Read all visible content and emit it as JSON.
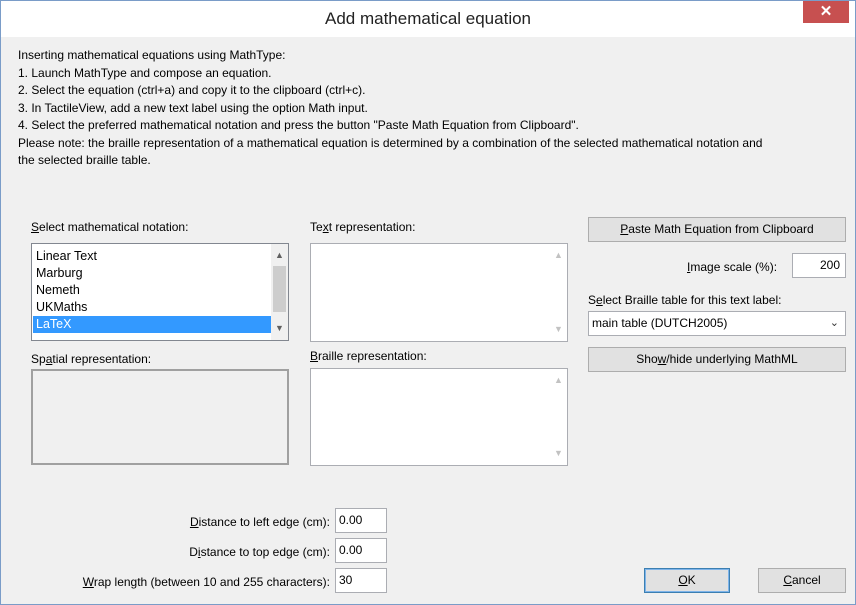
{
  "window": {
    "title": "Add mathematical equation",
    "close_glyph": "✕"
  },
  "instructions": [
    "Inserting mathematical equations using MathType:",
    "1. Launch MathType and compose an equation.",
    "2. Select the equation (ctrl+a) and copy it to the clipboard (ctrl+c).",
    "3. In TactileView, add a new text label using the option Math input.",
    "4. Select the preferred mathematical notation and press the button  \"Paste Math Equation from Clipboard\".",
    "Please note: the braille representation of a mathematical equation is determined by a combination of the selected mathematical notation and",
    "the selected braille table."
  ],
  "notation": {
    "label_mnemonic": "S",
    "label_rest": "elect mathematical notation:",
    "items": [
      "Linear Text",
      "Marburg",
      "Nemeth",
      "UKMaths",
      "LaTeX"
    ],
    "selected": "LaTeX"
  },
  "text_repr": {
    "label_pre": "Te",
    "label_mnemonic": "x",
    "label_post": "t representation:"
  },
  "braille_repr": {
    "label_mnemonic": "B",
    "label_rest": "raille representation:"
  },
  "spatial": {
    "label_pre": "Sp",
    "label_mnemonic": "a",
    "label_post": "tial representation:"
  },
  "paste_button": {
    "mnemonic": "P",
    "rest": "aste Math Equation from Clipboard"
  },
  "image_scale": {
    "label_mnemonic": "I",
    "label_rest": "mage scale (%):",
    "value": "200"
  },
  "braille_table": {
    "label_pre": "S",
    "label_mnemonic": "e",
    "label_post": "lect Braille table for this text label:",
    "selected": "main table (DUTCH2005)"
  },
  "mathml_button": {
    "pre": "Sho",
    "mnemonic": "w",
    "post": "/hide underlying MathML"
  },
  "distance_left": {
    "label_mnemonic": "D",
    "label_rest": "istance to left edge (cm):",
    "value": "0.00"
  },
  "distance_top": {
    "label_pre": "D",
    "label_mnemonic": "i",
    "label_post": "stance to top edge (cm):",
    "value": "0.00"
  },
  "wrap_length": {
    "label_mnemonic": "W",
    "label_rest": "rap length (between 10 and 255 characters):",
    "value": "30"
  },
  "ok_button": {
    "mnemonic": "O",
    "rest": "K"
  },
  "cancel_button": {
    "mnemonic": "C",
    "rest": "ancel"
  },
  "icons": {
    "scroll_up": "▲",
    "scroll_down": "▼",
    "dropdown": "⌄"
  },
  "colors": {
    "selection": "#3399ff",
    "close": "#c75050",
    "dialog_bg": "#f0f0f0"
  }
}
